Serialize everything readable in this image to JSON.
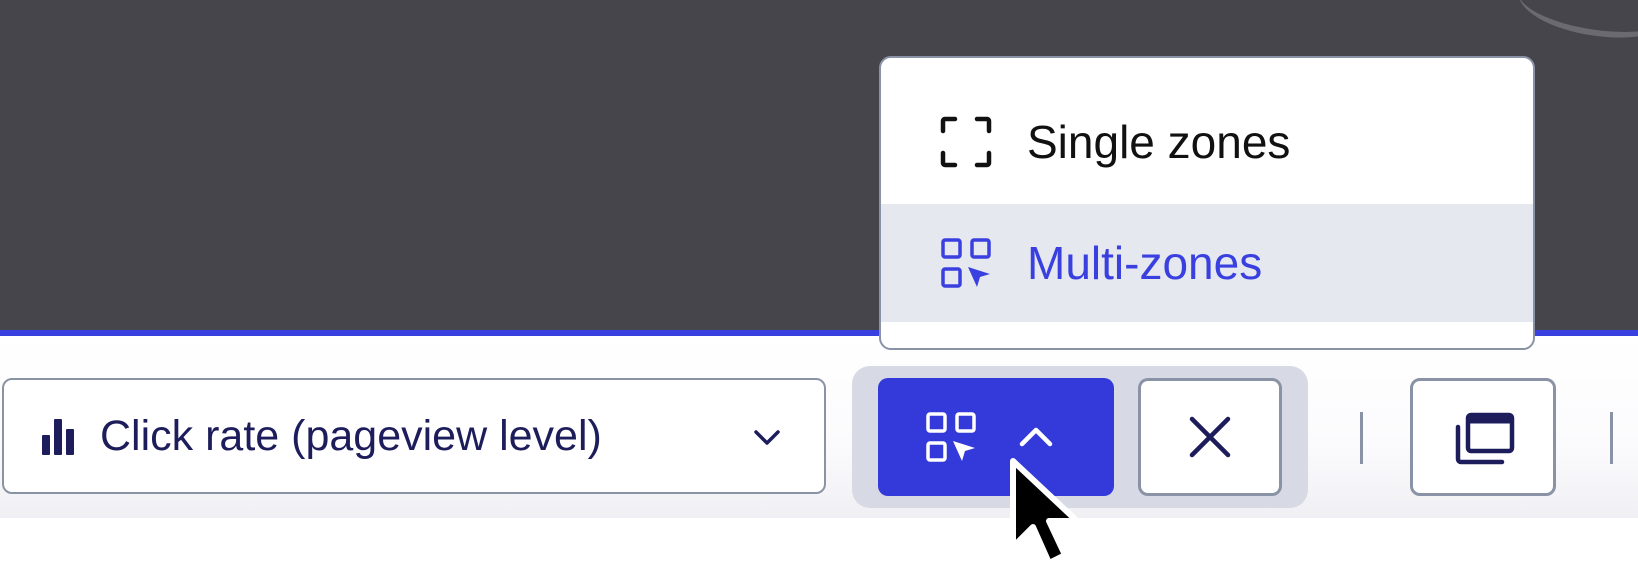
{
  "toolbar": {
    "metric_select": {
      "label": "Click rate (pageview level)",
      "icon": "bar-chart-icon",
      "caret": "chevron-down-icon"
    },
    "zone_mode_button": {
      "icon": "multi-zones-icon",
      "caret": "chevron-up-icon",
      "active": true
    },
    "close_button": {
      "icon": "close-icon"
    },
    "window_button": {
      "icon": "windows-icon"
    }
  },
  "zone_menu": {
    "items": [
      {
        "label": "Single zones",
        "icon": "single-zone-icon",
        "selected": false
      },
      {
        "label": "Multi-zones",
        "icon": "multi-zones-icon",
        "selected": true
      }
    ]
  },
  "colors": {
    "accent": "#343ad9",
    "selected_text": "#3a40e0",
    "dark_background": "#47454c",
    "selected_row": "#e6e8ef"
  }
}
